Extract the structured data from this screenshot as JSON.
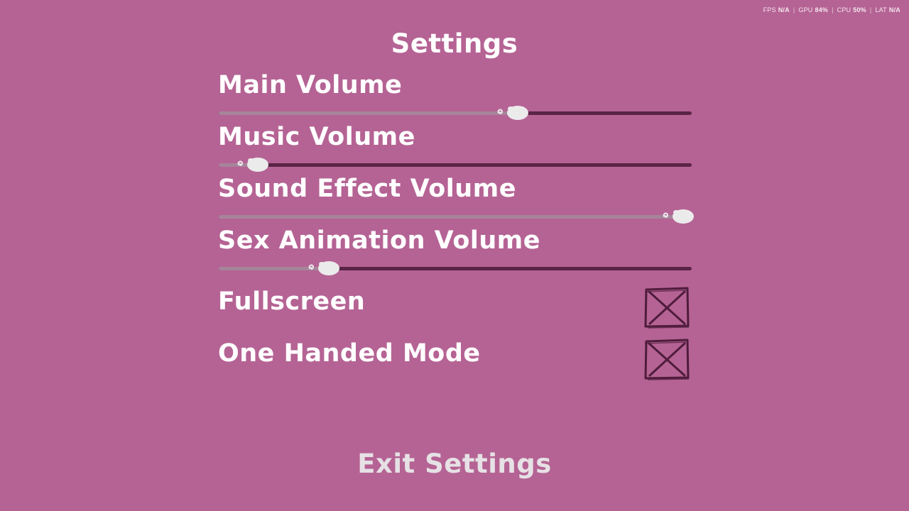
{
  "performance": {
    "fps_label": "FPS",
    "fps_value": "N/A",
    "gpu_label": "GPU",
    "gpu_value": "84%",
    "cpu_label": "CPU",
    "cpu_value": "50%",
    "lat_label": "LAT",
    "lat_value": "N/A",
    "separator": "|"
  },
  "title": "Settings",
  "sliders": [
    {
      "label": "Main Volume",
      "value": 0.65
    },
    {
      "label": "Music Volume",
      "value": 0.1
    },
    {
      "label": "Sound Effect Volume",
      "value": 1.0
    },
    {
      "label": "Sex Animation Volume",
      "value": 0.25
    }
  ],
  "toggles": [
    {
      "label": "Fullscreen",
      "checked": true
    },
    {
      "label": "One Handed Mode",
      "checked": true
    }
  ],
  "exit_label": "Exit Settings",
  "colors": {
    "background": "#b56394",
    "track_filled": "#a6849a",
    "track_empty": "#5a2446",
    "knob": "#ecebec",
    "checkbox_stroke": "#4f1c3c",
    "exit_text": "#e6e1e5"
  }
}
